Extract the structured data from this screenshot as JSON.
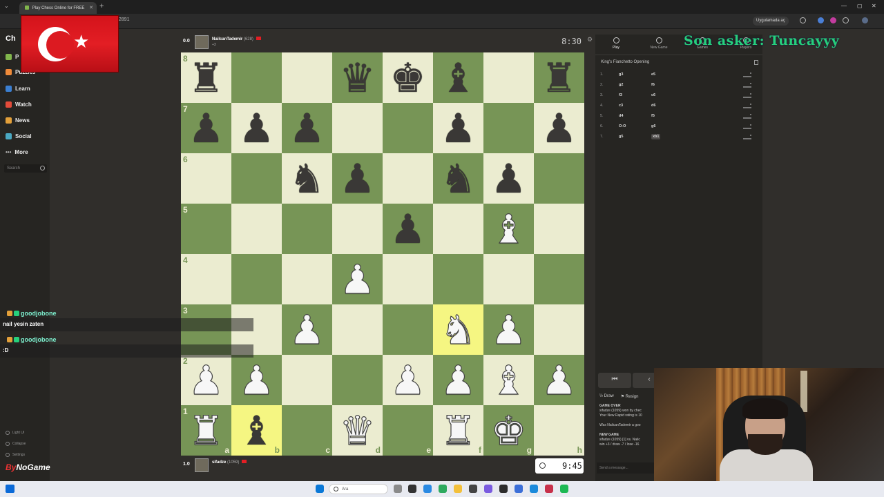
{
  "browser": {
    "tab_title": "Play Chess Online for FREE",
    "url_fragment": "12891",
    "app_button": "Uygulamada aç"
  },
  "nav": {
    "logo": "Ch",
    "items": [
      {
        "label": "P",
        "color": "#81b64c"
      },
      {
        "label": "Puzzles",
        "color": "#f08b3a"
      },
      {
        "label": "Learn",
        "color": "#3b7fd1"
      },
      {
        "label": "Watch",
        "color": "#e34b3a"
      },
      {
        "label": "News",
        "color": "#e3a03a"
      },
      {
        "label": "Social",
        "color": "#4aa8c2"
      },
      {
        "label": "More",
        "color": "#bbbbbb"
      }
    ],
    "search_placeholder": "Search",
    "bottom": [
      "Light UI",
      "Collapse",
      "Settings",
      "Help"
    ]
  },
  "top_player": {
    "score": "0.0",
    "name": "NailcanTademir",
    "rating": "(628)",
    "extra": "+3",
    "clock": "8:30"
  },
  "bottom_player": {
    "score": "1.0",
    "name": "sifadze",
    "rating": "(1059)",
    "clock": "9:45"
  },
  "board": {
    "ranks": [
      "8",
      "7",
      "6",
      "5",
      "4",
      "3",
      "2",
      "1"
    ],
    "files": [
      "a",
      "b",
      "c",
      "d",
      "e",
      "f",
      "g",
      "h"
    ],
    "rows": [
      [
        "br",
        "",
        "",
        "bq",
        "bk",
        "bb",
        "",
        "br"
      ],
      [
        "bp",
        "bp",
        "bp",
        "",
        "",
        "bp",
        "",
        "bp"
      ],
      [
        "",
        "",
        "bn",
        "bp",
        "",
        "bn",
        "bp",
        ""
      ],
      [
        "",
        "",
        "",
        "",
        "bp",
        "",
        "wb",
        ""
      ],
      [
        "",
        "",
        "",
        "wp",
        "",
        "",
        "",
        ""
      ],
      [
        "",
        "",
        "wp",
        "",
        "",
        "wn",
        "wp",
        ""
      ],
      [
        "wp",
        "wp",
        "",
        "",
        "wp",
        "wp",
        "wb",
        "wp"
      ],
      [
        "wr",
        "bb",
        "",
        "wq",
        "",
        "wr",
        "wk",
        ""
      ]
    ],
    "highlight": [
      "5-5",
      "7-1"
    ]
  },
  "chat": [
    {
      "user": "goodjobone",
      "text": "nail yesin zaten"
    },
    {
      "user": "goodjobone",
      "text": ":D"
    }
  ],
  "overlay_text": "Son asker: Tuncayyy",
  "right_panel": {
    "tabs": [
      "Play",
      "New Game",
      "Games",
      "Players"
    ],
    "opening": "King's Fianchetto Opening",
    "moves": [
      {
        "n": "1.",
        "w": "g3",
        "b": "e5"
      },
      {
        "n": "2.",
        "w": "g2",
        "b": "f6"
      },
      {
        "n": "3.",
        "w": "f3",
        "b": "c6"
      },
      {
        "n": "4.",
        "w": "c3",
        "b": "d6"
      },
      {
        "n": "5.",
        "w": "d4",
        "b": "f5"
      },
      {
        "n": "6.",
        "w": "O-O",
        "b": "g6"
      },
      {
        "n": "7.",
        "w": "g5",
        "b": "xb1"
      }
    ],
    "actions": [
      "Draw",
      "Resign"
    ],
    "log_lines": [
      "GAME OVER",
      "sifadze (1059) won by chec",
      "Your New Rapid rating is 10",
      "",
      "Was NailcanTademir a goo",
      "",
      "NEW GAME",
      "sifadze (1059) [1] vs. Nailc",
      "win +3 / draw -7 / lose -16"
    ],
    "send_placeholder": "Send a message..."
  },
  "taskbar": {
    "search_placeholder": "Ara"
  },
  "brand": {
    "left": "By",
    "right": "NoGame"
  }
}
